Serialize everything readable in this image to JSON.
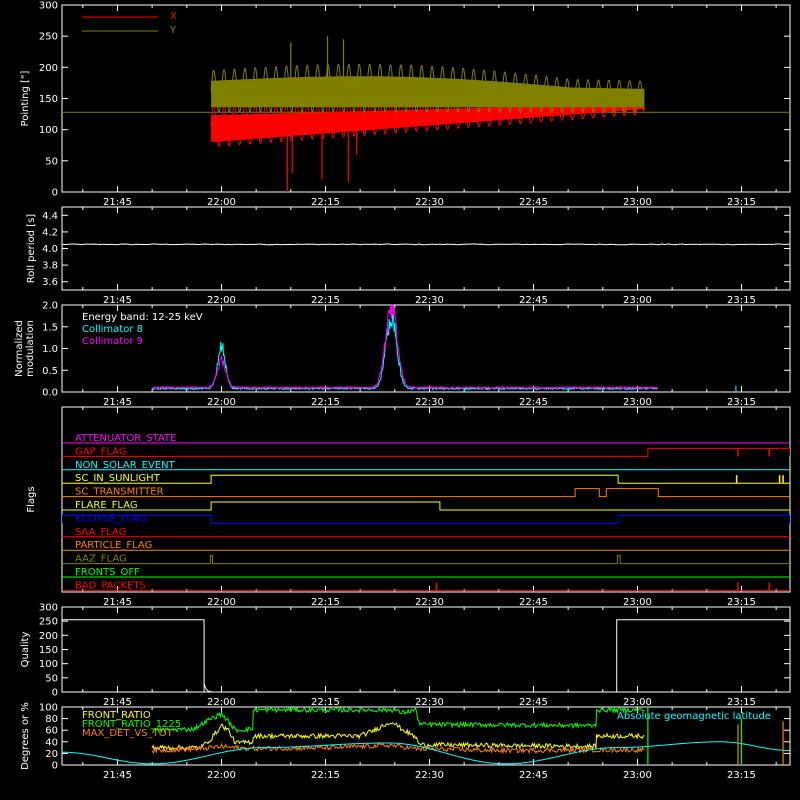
{
  "chart_data": {
    "type": "line",
    "time_axis": {
      "start": "21:37",
      "end": "23:22",
      "tick_labels": [
        "21:45",
        "22:00",
        "22:15",
        "22:30",
        "22:45",
        "23:00",
        "23:15"
      ],
      "tick_minutes": [
        525,
        540,
        555,
        570,
        585,
        600,
        615
      ],
      "range_minutes": [
        517,
        622
      ]
    },
    "panels": [
      {
        "id": "pointing",
        "ylabel": "Pointing [\"]",
        "ylim": [
          0,
          300
        ],
        "yticks": [
          0,
          50,
          100,
          150,
          200,
          250,
          300
        ],
        "legend": [
          {
            "name": "X",
            "color": "#ff0000"
          },
          {
            "name": "Y",
            "color": "#808000"
          }
        ],
        "reference_line": {
          "value": 128,
          "color": "#808000"
        },
        "series": [
          {
            "name": "X",
            "color": "#ff0000",
            "t_start": 538.5,
            "t_end": 601,
            "low_start": 72,
            "low_end": 125,
            "high_start": 140,
            "high_end": 148,
            "oscillation_period_min": 1.5
          },
          {
            "name": "Y",
            "color": "#808000",
            "t_start": 538.5,
            "t_end": 601,
            "low_start": 128,
            "low_end": 128,
            "high_start": 195,
            "high_end": 178,
            "peak_mid": 225,
            "oscillation_period_min": 1.5
          }
        ],
        "spikes": [
          {
            "t": 549.5,
            "value": 0,
            "color": "#ff0000"
          },
          {
            "t": 550.2,
            "value": 30,
            "color": "#ff0000"
          },
          {
            "t": 554.5,
            "value": 20,
            "color": "#ff0000"
          },
          {
            "t": 558.3,
            "value": 15,
            "color": "#ff0000"
          },
          {
            "t": 559.5,
            "value": 60,
            "color": "#ff0000"
          },
          {
            "t": 550,
            "value": 240,
            "color": "#808000"
          },
          {
            "t": 555.3,
            "value": 250,
            "color": "#808000"
          },
          {
            "t": 557.6,
            "value": 245,
            "color": "#808000"
          }
        ]
      },
      {
        "id": "roll",
        "ylabel": "Roll period [s]",
        "ylim": [
          3.5,
          4.5
        ],
        "yticks": [
          3.6,
          3.8,
          4.0,
          4.2,
          4.4
        ],
        "yticklabels": [
          "3.6",
          "3.8",
          "4.0",
          "4.2",
          "4.4"
        ],
        "series": [
          {
            "name": "roll",
            "color": "#ffffff",
            "t_start": 517,
            "t_end": 622,
            "value": 4.05
          }
        ]
      },
      {
        "id": "modulation",
        "ylabel": [
          "Normalized",
          "modulation"
        ],
        "ylim": [
          0,
          2.0
        ],
        "yticks": [
          0.0,
          0.5,
          1.0,
          1.5,
          2.0
        ],
        "yticklabels": [
          "0.0",
          "0.5",
          "1.0",
          "1.5",
          "2.0"
        ],
        "legend": [
          {
            "name": "Energy band: 12-25 keV",
            "color": "#ffffff"
          },
          {
            "name": "Collimator 8",
            "color": "#00ffff"
          },
          {
            "name": "Collimator 9",
            "color": "#ff00ff"
          }
        ],
        "series": [
          {
            "name": "Collimator 8",
            "color": "#00ffff",
            "t_start": 530,
            "t_end": 603,
            "baseline": 0.08,
            "peaks": [
              {
                "t": 540,
                "value": 1.1,
                "width": 0.8
              },
              {
                "t": 564.5,
                "value": 1.85,
                "width": 1.1
              }
            ]
          },
          {
            "name": "Collimator 9",
            "color": "#ff00ff",
            "t_start": 530,
            "t_end": 603,
            "baseline": 0.1,
            "peaks": [
              {
                "t": 540,
                "value": 0.75,
                "width": 0.9
              },
              {
                "t": 564.5,
                "value": 2.0,
                "width": 1.2
              }
            ]
          }
        ],
        "spikes": [
          {
            "t": 614.2,
            "value": 0.15,
            "color": "#00ffff"
          }
        ]
      },
      {
        "id": "flags",
        "ylabel": "Flags",
        "flags": [
          {
            "name": "ATTENUATOR_STATE",
            "color": "#ff00ff",
            "segments": []
          },
          {
            "name": "GAP_FLAG",
            "color": "#ff0000",
            "segments": [
              [
                601.5,
                622
              ]
            ],
            "ticks": [
              614.5,
              619
            ]
          },
          {
            "name": "NON_SOLAR_EVENT",
            "color": "#00ffff",
            "segments": []
          },
          {
            "name": "SC_IN_SUNLIGHT",
            "color": "#ffff00",
            "segments": [
              [
                538.5,
                597.2
              ]
            ],
            "ticks": [
              614.3,
              620.5,
              621
            ]
          },
          {
            "name": "SC_TRANSMITTER",
            "color": "#ff8000",
            "segments": [
              [
                591,
                594.5
              ],
              [
                595.5,
                603
              ]
            ]
          },
          {
            "name": "FLARE_FLAG",
            "color": "#ffff00",
            "segments": [
              [
                538.5,
                571.5
              ]
            ]
          },
          {
            "name": "ECLIPSE_FLAG",
            "color": "#0000ff",
            "segments": [
              [
                517,
                538.5
              ],
              [
                597.2,
                622
              ]
            ]
          },
          {
            "name": "SAA_FLAG",
            "color": "#ff0000",
            "segments": []
          },
          {
            "name": "PARTICLE_FLAG",
            "color": "#ff8000",
            "segments": []
          },
          {
            "name": "AAZ_FLAG",
            "color": "#808000",
            "segments": [
              [
                538.4,
                538.7
              ],
              [
                597.1,
                597.5
              ]
            ]
          },
          {
            "name": "FRONTS_OFF",
            "color": "#00ff00",
            "segments": []
          },
          {
            "name": "BAD_PACKETS",
            "color": "#ff0000",
            "segments": [],
            "ticks": [
              571,
              614.5,
              619
            ]
          }
        ]
      },
      {
        "id": "quality",
        "ylabel": "Quality",
        "ylim": [
          0,
          300
        ],
        "yticks": [
          0,
          50,
          100,
          150,
          200,
          250,
          300
        ],
        "series": [
          {
            "name": "quality",
            "color": "#ffffff",
            "segments": [
              [
                517,
                537.5,
                255
              ],
              [
                537.5,
                539,
                0
              ],
              [
                597,
                622,
                255
              ]
            ]
          }
        ]
      },
      {
        "id": "ratios",
        "ylabel": "Degrees or %",
        "ylim": [
          0,
          100
        ],
        "yticks": [
          0,
          20,
          40,
          60,
          80,
          100
        ],
        "legend": [
          {
            "name": "FRONT_RATIO",
            "color": "#ffff00"
          },
          {
            "name": "FRONT_RATIO_1225",
            "color": "#00ff00"
          },
          {
            "name": "MAX_DET_VS_TOT",
            "color": "#ff8000"
          }
        ],
        "annotation": {
          "text": "Absolute geomagnetic latitude",
          "color": "#00ffff"
        },
        "series": [
          {
            "name": "FRONT_RATIO_1225",
            "color": "#00ff00",
            "points": [
              [
                530,
                60
              ],
              [
                536,
                62
              ],
              [
                538.5,
                80
              ],
              [
                540,
                88
              ],
              [
                541,
                75
              ],
              [
                542,
                60
              ],
              [
                544.5,
                62
              ],
              [
                544.6,
                95
              ],
              [
                565,
                95
              ],
              [
                566,
                90
              ],
              [
                568,
                95
              ],
              [
                568.6,
                70
              ],
              [
                594,
                68
              ],
              [
                594.1,
                95
              ],
              [
                601,
                95
              ]
            ]
          },
          {
            "name": "FRONT_RATIO",
            "color": "#ffff00",
            "points": [
              [
                530,
                30
              ],
              [
                537,
                30
              ],
              [
                538.5,
                45
              ],
              [
                540,
                68
              ],
              [
                541,
                60
              ],
              [
                542,
                38
              ],
              [
                544.5,
                40
              ],
              [
                544.6,
                50
              ],
              [
                560,
                50
              ],
              [
                562,
                60
              ],
              [
                564.5,
                75
              ],
              [
                566,
                62
              ],
              [
                568,
                48
              ],
              [
                568.6,
                35
              ],
              [
                594,
                32
              ],
              [
                594.1,
                50
              ],
              [
                601,
                50
              ]
            ]
          },
          {
            "name": "MAX_DET_VS_TOT",
            "color": "#ff8000",
            "points": [
              [
                530,
                25
              ],
              [
                537,
                28
              ],
              [
                540,
                32
              ],
              [
                544,
                28
              ],
              [
                556,
                30
              ],
              [
                564.5,
                34
              ],
              [
                568,
                28
              ],
              [
                580,
                25
              ],
              [
                594,
                26
              ],
              [
                601,
                26
              ]
            ]
          },
          {
            "name": "Absolute geomagnetic latitude",
            "color": "#00ffff",
            "points": [
              [
                517,
                22
              ],
              [
                530,
                2
              ],
              [
                546,
                30
              ],
              [
                564,
                38
              ],
              [
                581,
                2
              ],
              [
                597,
                30
              ],
              [
                612,
                40
              ],
              [
                622,
                25
              ]
            ]
          }
        ],
        "spikes": [
          {
            "t": 601.5,
            "value": 100,
            "color": "#00ff00"
          },
          {
            "t": 614.5,
            "value": 70,
            "color": "#ff8000"
          },
          {
            "t": 615,
            "value": 80,
            "color": "#00ff00"
          },
          {
            "t": 621,
            "value": 75,
            "color": "#ff8000"
          }
        ]
      }
    ]
  }
}
